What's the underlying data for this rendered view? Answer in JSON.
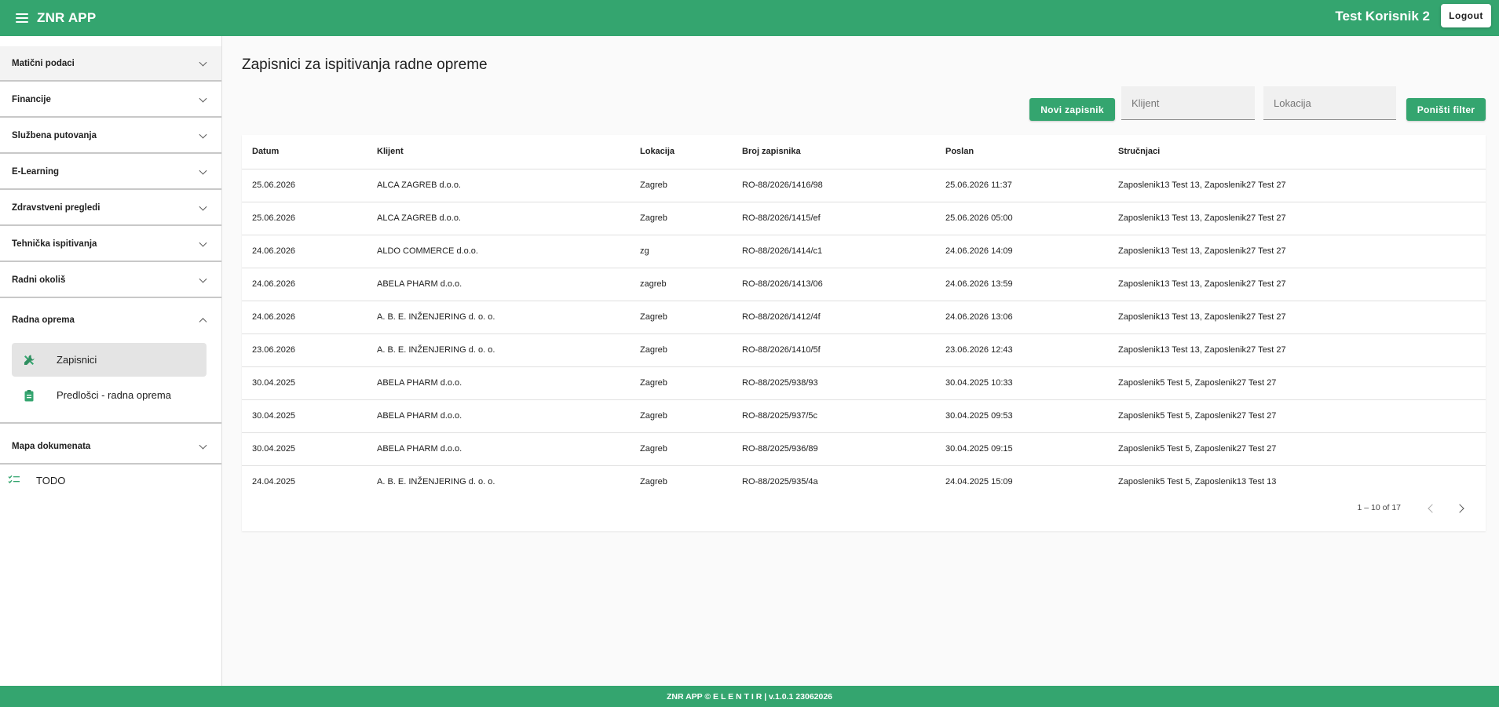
{
  "app": {
    "title": "ZNR APP",
    "user": "Test Korisnik 2",
    "logout_label": "Logout"
  },
  "sidebar": {
    "sections": [
      {
        "label": "Matični podaci"
      },
      {
        "label": "Financije"
      },
      {
        "label": "Službena putovanja"
      },
      {
        "label": "E-Learning"
      },
      {
        "label": "Zdravstveni pregledi"
      },
      {
        "label": "Tehnička ispitivanja"
      },
      {
        "label": "Radni okoliš"
      },
      {
        "label": "Radna oprema"
      },
      {
        "label": "Mapa dokumenata"
      }
    ],
    "sub_items": [
      {
        "label": "Zapisnici",
        "icon": "tools-icon",
        "active": true
      },
      {
        "label": "Predlošci - radna oprema",
        "icon": "clipboard-icon",
        "active": false
      }
    ],
    "todo": {
      "label": "TODO",
      "icon": "checklist-icon"
    }
  },
  "main": {
    "title": "Zapisnici za ispitivanja radne opreme",
    "new_button": "Novi zapisnik",
    "filter_client_placeholder": "Klijent",
    "filter_location_placeholder": "Lokacija",
    "reset_button": "Poništi filter",
    "columns": [
      "Datum",
      "Klijent",
      "Lokacija",
      "Broj zapisnika",
      "Poslan",
      "Stručnjaci"
    ],
    "rows": [
      [
        "25.06.2026",
        "ALCA ZAGREB d.o.o.",
        "Zagreb",
        "RO-88/2026/1416/98",
        "25.06.2026 11:37",
        "Zaposlenik13 Test 13, Zaposlenik27 Test 27"
      ],
      [
        "25.06.2026",
        "ALCA ZAGREB d.o.o.",
        "Zagreb",
        "RO-88/2026/1415/ef",
        "25.06.2026 05:00",
        "Zaposlenik13 Test 13, Zaposlenik27 Test 27"
      ],
      [
        "24.06.2026",
        "ALDO COMMERCE d.o.o.",
        "zg",
        "RO-88/2026/1414/c1",
        "24.06.2026 14:09",
        "Zaposlenik13 Test 13, Zaposlenik27 Test 27"
      ],
      [
        "24.06.2026",
        "ABELA PHARM d.o.o.",
        "zagreb",
        "RO-88/2026/1413/06",
        "24.06.2026 13:59",
        "Zaposlenik13 Test 13, Zaposlenik27 Test 27"
      ],
      [
        "24.06.2026",
        "A. B. E. INŽENJERING d. o. o.",
        "Zagreb",
        "RO-88/2026/1412/4f",
        "24.06.2026 13:06",
        "Zaposlenik13 Test 13, Zaposlenik27 Test 27"
      ],
      [
        "23.06.2026",
        "A. B. E. INŽENJERING d. o. o.",
        "Zagreb",
        "RO-88/2026/1410/5f",
        "23.06.2026 12:43",
        "Zaposlenik13 Test 13, Zaposlenik27 Test 27"
      ],
      [
        "30.04.2025",
        "ABELA PHARM d.o.o.",
        "Zagreb",
        "RO-88/2025/938/93",
        "30.04.2025 10:33",
        "Zaposlenik5 Test 5, Zaposlenik27 Test 27"
      ],
      [
        "30.04.2025",
        "ABELA PHARM d.o.o.",
        "Zagreb",
        "RO-88/2025/937/5c",
        "30.04.2025 09:53",
        "Zaposlenik5 Test 5, Zaposlenik27 Test 27"
      ],
      [
        "30.04.2025",
        "ABELA PHARM d.o.o.",
        "Zagreb",
        "RO-88/2025/936/89",
        "30.04.2025 09:15",
        "Zaposlenik5 Test 5, Zaposlenik27 Test 27"
      ],
      [
        "24.04.2025",
        "A. B. E. INŽENJERING d. o. o.",
        "Zagreb",
        "RO-88/2025/935/4a",
        "24.04.2025 15:09",
        "Zaposlenik5 Test 5, Zaposlenik13 Test 13"
      ]
    ],
    "pagination": "1 – 10 of 17"
  },
  "footer": {
    "text": "ZNR APP © E L E N T I R | v.1.0.1 23062026"
  },
  "colors": {
    "brand": "#34a56f",
    "active_item_bg": "#e4e4e4"
  }
}
